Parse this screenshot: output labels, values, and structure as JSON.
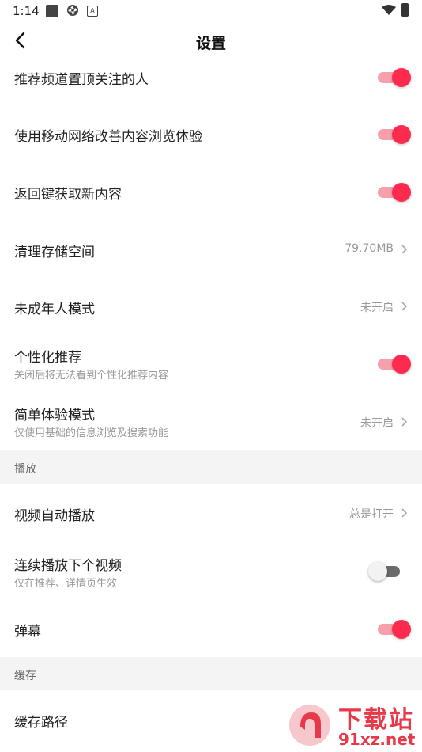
{
  "status_bar": {
    "time": "1:14",
    "badge_letter": "A"
  },
  "nav": {
    "title": "设置"
  },
  "settings": [
    {
      "title": "推荐频道置顶关注的人",
      "toggle": "on"
    },
    {
      "title": "使用移动网络改善内容浏览体验",
      "toggle": "on"
    },
    {
      "title": "返回键获取新内容",
      "toggle": "on"
    },
    {
      "title": "清理存储空间",
      "value": "79.70MB"
    },
    {
      "title": "未成年人模式",
      "value": "未开启"
    },
    {
      "title": "个性化推荐",
      "subtitle": "关闭后将无法看到个性化推荐内容",
      "toggle": "on"
    },
    {
      "title": "简单体验模式",
      "subtitle": "仅使用基础的信息浏览及搜索功能",
      "value": "未开启"
    }
  ],
  "sections": {
    "playback": {
      "header": "播放",
      "items": [
        {
          "title": "视频自动播放",
          "value": "总是打开"
        },
        {
          "title": "连续播放下个视频",
          "subtitle": "仅在推荐、详情页生效",
          "toggle": "off"
        },
        {
          "title": "弹幕",
          "toggle": "on"
        }
      ]
    },
    "cache": {
      "header": "缓存",
      "items": [
        {
          "title": "缓存路径"
        }
      ]
    }
  },
  "watermark": {
    "brand": "下载站",
    "domain": "91xz.net"
  },
  "colors": {
    "accent": "#ff2b4f",
    "accent_track": "#f7a0ab",
    "section_bg": "#f4f4f4"
  }
}
